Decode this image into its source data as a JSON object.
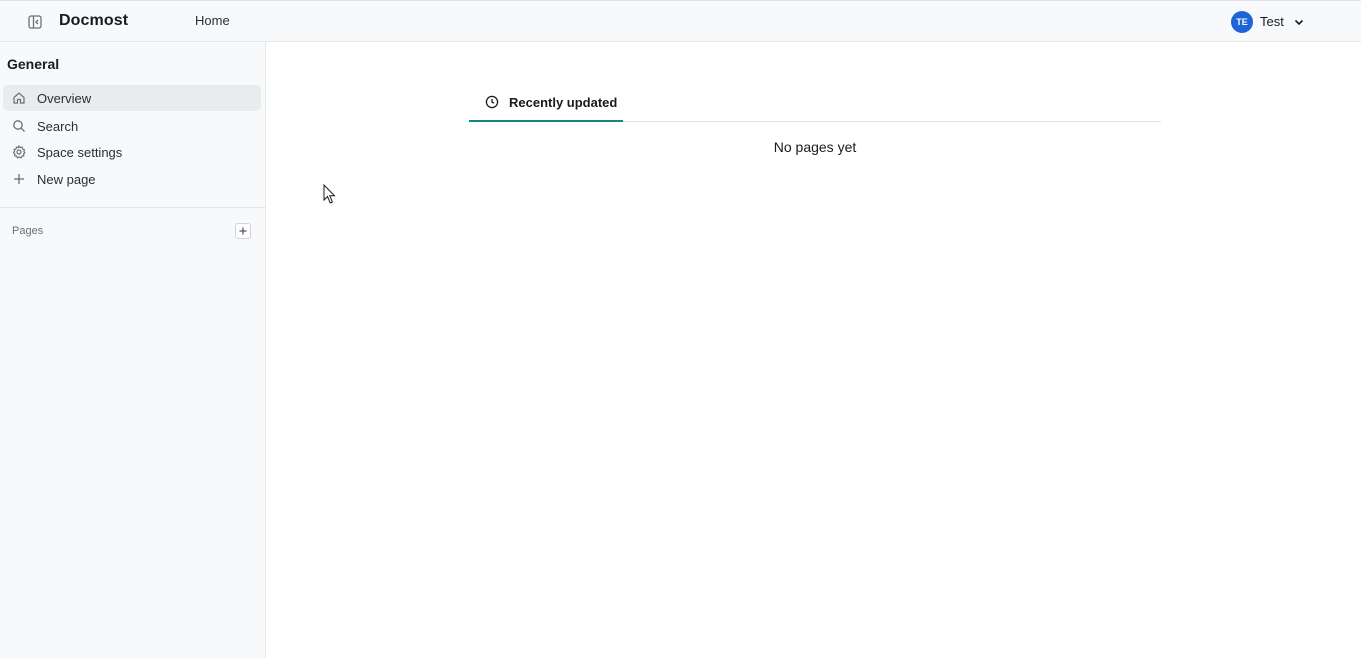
{
  "header": {
    "brand": "Docmost",
    "home_label": "Home",
    "user": {
      "initials": "TE",
      "name": "Test"
    }
  },
  "sidebar": {
    "space_title": "General",
    "items": [
      {
        "label": "Overview",
        "icon": "home-icon"
      },
      {
        "label": "Search",
        "icon": "search-icon"
      },
      {
        "label": "Space settings",
        "icon": "gear-icon"
      },
      {
        "label": "New page",
        "icon": "plus-icon"
      }
    ],
    "pages_label": "Pages"
  },
  "main": {
    "tab_label": "Recently updated",
    "empty_text": "No pages yet"
  },
  "colors": {
    "accent": "#12848a",
    "avatar": "#1c64d8"
  }
}
